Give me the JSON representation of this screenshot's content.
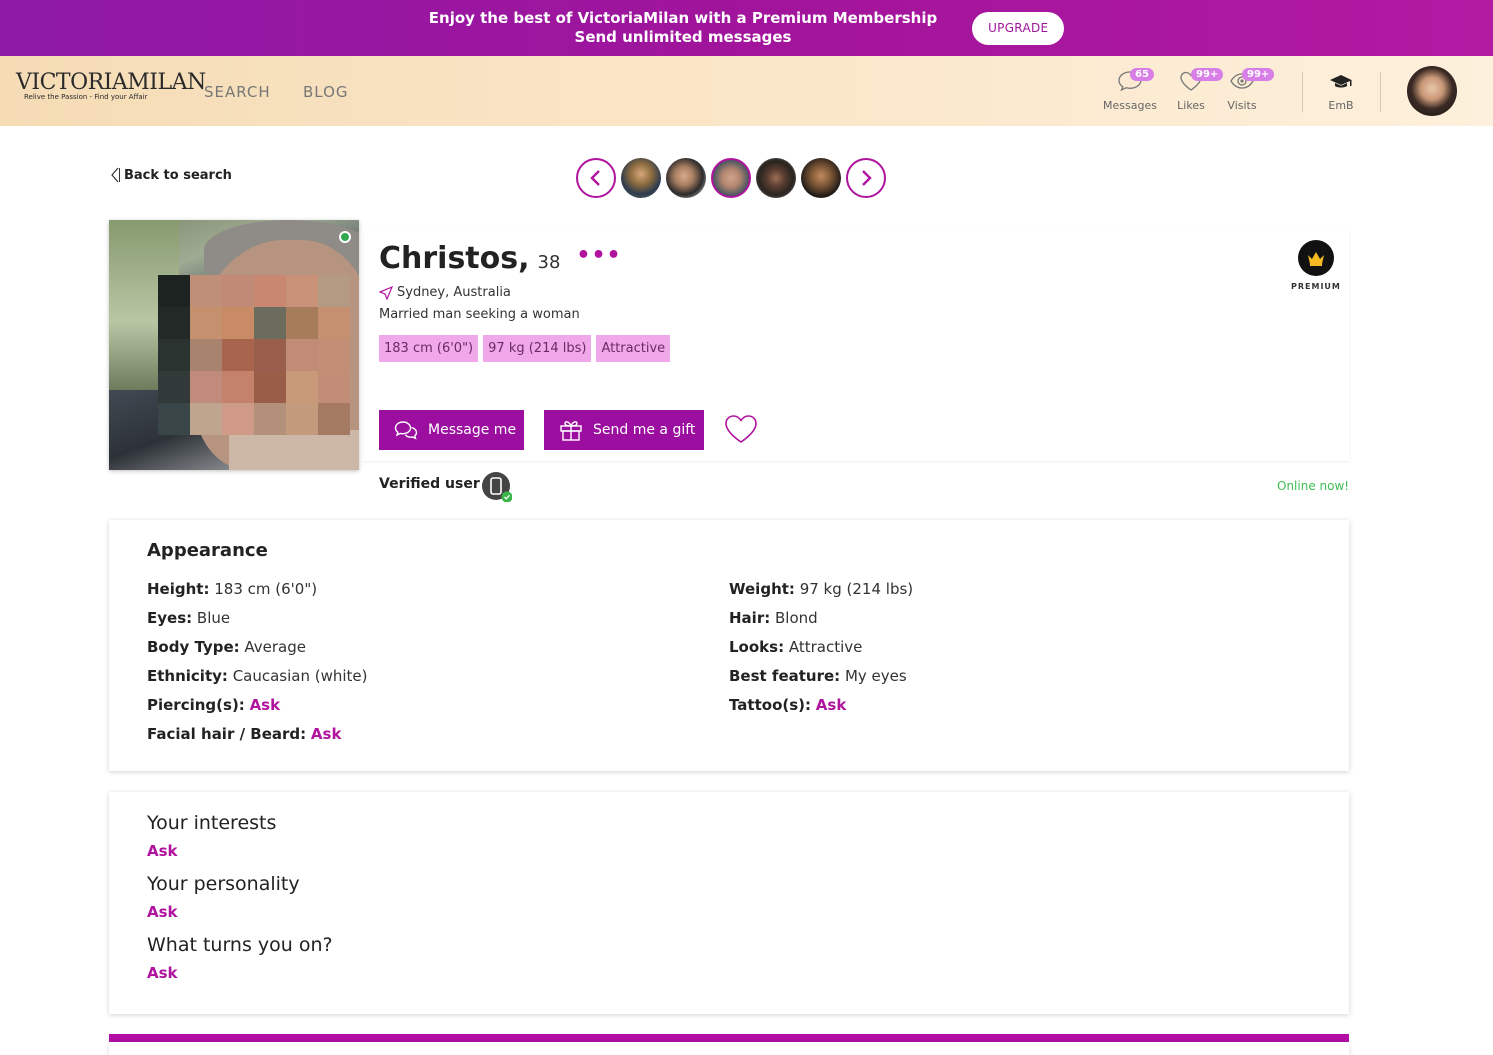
{
  "promo": {
    "line1": "Enjoy the best of VictoriaMilan with a Premium Membership",
    "line2": "Send unlimited messages",
    "upgrade_label": "UPGRADE"
  },
  "header": {
    "logo_text": "VICTORIAMILAN",
    "logo_tagline": "Relive the Passion - Find your Affair",
    "nav": [
      "SEARCH",
      "BLOG"
    ],
    "messages": {
      "label": "Messages",
      "count": "65"
    },
    "likes": {
      "label": "Likes",
      "count": "99+"
    },
    "visits": {
      "label": "Visits",
      "count": "99+"
    },
    "emb": {
      "label": "EmB"
    }
  },
  "back_label": "Back to search",
  "profile": {
    "name": "Christos,",
    "age": "38",
    "more": "•••",
    "location": "Sydney, Australia",
    "seeking": "Married man seeking a woman",
    "tags": [
      "183 cm (6'0\")",
      "97 kg (214 lbs)",
      "Attractive"
    ],
    "message_label": "Message me",
    "gift_label": "Send me a gift",
    "premium_label": "PREMIUM",
    "verified_label": "Verified user",
    "online_label": "Online now!"
  },
  "appearance": {
    "title": "Appearance",
    "left": [
      {
        "key": "Height:",
        "value": "183 cm (6'0\")"
      },
      {
        "key": "Eyes:",
        "value": "Blue"
      },
      {
        "key": "Body Type:",
        "value": "Average"
      },
      {
        "key": "Ethnicity:",
        "value": "Caucasian (white)"
      },
      {
        "key": "Piercing(s):",
        "value": "Ask"
      },
      {
        "key": "Facial hair / Beard:",
        "value": "Ask"
      }
    ],
    "right": [
      {
        "key": "Weight:",
        "value": "97 kg (214 lbs)"
      },
      {
        "key": "Hair:",
        "value": "Blond"
      },
      {
        "key": "Looks:",
        "value": "Attractive"
      },
      {
        "key": "Best feature:",
        "value": "My eyes"
      },
      {
        "key": "Tattoo(s):",
        "value": "Ask"
      }
    ]
  },
  "interests": [
    {
      "question": "Your interests",
      "answer": "Ask"
    },
    {
      "question": "Your personality",
      "answer": "Ask"
    },
    {
      "question": "What turns you on?",
      "answer": "Ask"
    }
  ],
  "colors": {
    "accent": "#b0149f",
    "button": "#9b0ea0",
    "tag": "#f0a8ea",
    "online": "#3fbd53"
  }
}
